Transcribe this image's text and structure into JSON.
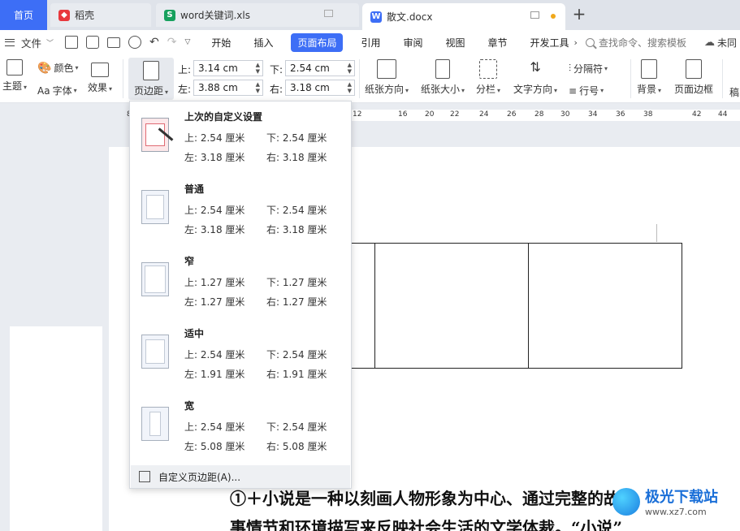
{
  "tabs": {
    "home": "首页",
    "daoke": "稻壳",
    "xls": "word关键词.xls",
    "docx": "散文.docx"
  },
  "menu": {
    "file": "文件",
    "items": [
      "开始",
      "插入",
      "页面布局",
      "引用",
      "审阅",
      "视图",
      "章节",
      "开发工具"
    ],
    "active": "页面布局",
    "search": "查找命令、搜索模板",
    "cloud": "未同"
  },
  "ribbon": {
    "theme": "主题",
    "color": "颜色",
    "font": "字体",
    "effect": "效果",
    "margins": "页边距",
    "top_label": "上:",
    "top_value": "3.14 cm",
    "bottom_label": "下:",
    "bottom_value": "2.54 cm",
    "left_label": "左:",
    "left_value": "3.88 cm",
    "right_label": "右:",
    "right_value": "3.18 cm",
    "orientation": "纸张方向",
    "paper_size": "纸张大小",
    "columns": "分栏",
    "text_direction": "文字方向",
    "separator": "分隔符",
    "line_number": "行号",
    "background": "背景",
    "page_border": "页面边框",
    "more": "稿"
  },
  "ruler": [
    "8",
    "12",
    "16",
    "20",
    "22",
    "24",
    "26",
    "28",
    "30",
    "34",
    "36",
    "38",
    "42",
    "44"
  ],
  "margin_presets": [
    {
      "name": "上次的自定义设置",
      "top": "上: 2.54 厘米",
      "bottom": "下: 2.54 厘米",
      "left": "左: 3.18 厘米",
      "right": "右: 3.18 厘米"
    },
    {
      "name": "普通",
      "top": "上: 2.54 厘米",
      "bottom": "下: 2.54 厘米",
      "left": "左: 3.18 厘米",
      "right": "右: 3.18 厘米"
    },
    {
      "name": "窄",
      "top": "上: 1.27 厘米",
      "bottom": "下: 1.27 厘米",
      "left": "左: 1.27 厘米",
      "right": "右: 1.27 厘米"
    },
    {
      "name": "适中",
      "top": "上: 2.54 厘米",
      "bottom": "下: 2.54 厘米",
      "left": "左: 1.91 厘米",
      "right": "右: 1.91 厘米"
    },
    {
      "name": "宽",
      "top": "上: 2.54 厘米",
      "bottom": "下: 2.54 厘米",
      "left": "左: 5.08 厘米",
      "right": "右: 5.08 厘米"
    }
  ],
  "custom_margins": "自定义页边距(A)...",
  "document": {
    "line1": "①＋小说是一种以刻画人物形象为中心、通过完整的故",
    "line2": "事情节和环境描写来反映社会生活的文学体裁。“小说”"
  },
  "watermark": {
    "title": "极光下载站",
    "url": "www.xz7.com"
  }
}
